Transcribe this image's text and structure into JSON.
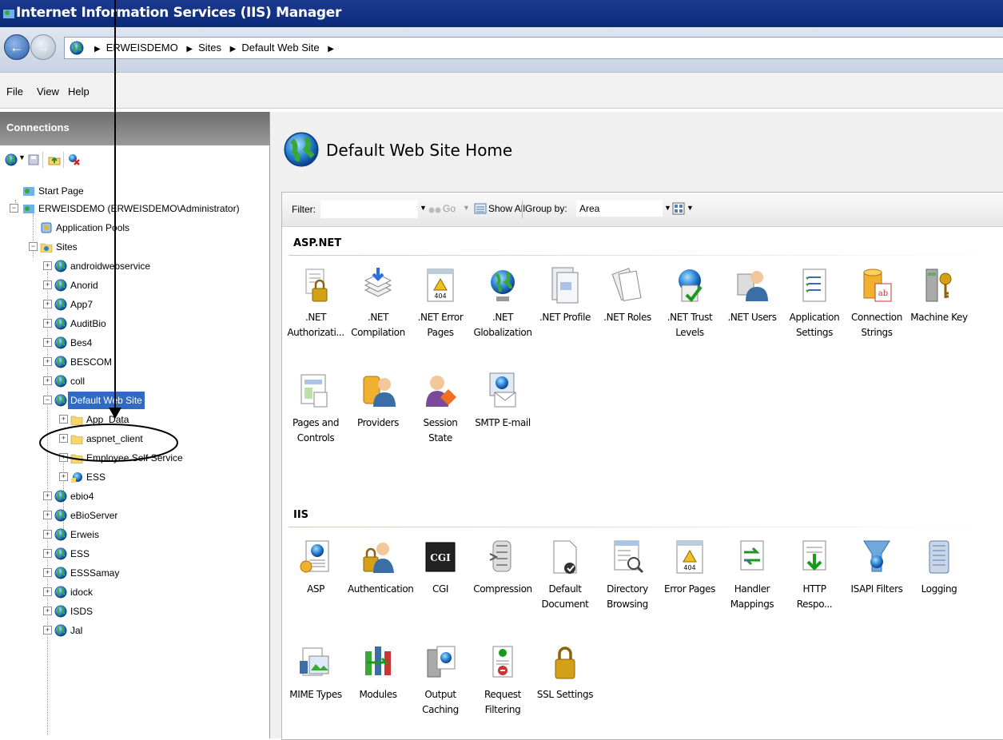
{
  "window": {
    "title": "Internet Information Services (IIS) Manager"
  },
  "address": {
    "crumbs": [
      "ERWEISDEMO",
      "Sites",
      "Default Web Site"
    ]
  },
  "menu": [
    "File",
    "View",
    "Help"
  ],
  "connections": {
    "header": "Connections",
    "tree": {
      "start_page": "Start Page",
      "server": "ERWEISDEMO (ERWEISDEMO\\Administrator)",
      "app_pools": "Application Pools",
      "sites": "Sites",
      "site_items": [
        "androidwebservice",
        "Anorid",
        "App7",
        "AuditBio",
        "Bes4",
        "BESCOM",
        "coll"
      ],
      "selected_site": "Default Web Site",
      "children": [
        "App_Data",
        "aspnet_client",
        "Employee Self Service",
        "ESS"
      ],
      "more_sites": [
        "ebio4",
        "eBioServer",
        "Erweis",
        "ESS",
        "ESSSamay",
        "idock",
        "ISDS",
        "Jal"
      ]
    }
  },
  "main": {
    "title": "Default Web Site Home",
    "filter": {
      "label": "Filter:",
      "go": "Go",
      "show_all": "Show All",
      "group_by_label": "Group by:",
      "group_by_value": "Area"
    },
    "sections": [
      {
        "name": "ASP.NET",
        "items": [
          {
            "l1": ".NET",
            "l2": "Authorizati...",
            "icon": "lock-icon"
          },
          {
            "l1": ".NET",
            "l2": "Compilation",
            "icon": "stack-icon"
          },
          {
            "l1": ".NET Error",
            "l2": "Pages",
            "icon": "warning-404-icon"
          },
          {
            "l1": ".NET",
            "l2": "Globalization",
            "icon": "globe-icon"
          },
          {
            "l1": ".NET Profile",
            "l2": "",
            "icon": "profile-icon"
          },
          {
            "l1": ".NET Roles",
            "l2": "",
            "icon": "roles-icon"
          },
          {
            "l1": ".NET Trust",
            "l2": "Levels",
            "icon": "trust-icon"
          },
          {
            "l1": ".NET Users",
            "l2": "",
            "icon": "users-icon"
          },
          {
            "l1": "Application",
            "l2": "Settings",
            "icon": "settings-list-icon"
          },
          {
            "l1": "Connection",
            "l2": "Strings",
            "icon": "db-icon"
          },
          {
            "l1": "Machine Key",
            "l2": "",
            "icon": "key-icon"
          },
          {
            "l1": "Pages and",
            "l2": "Controls",
            "icon": "pages-icon"
          },
          {
            "l1": "Providers",
            "l2": "",
            "icon": "providers-icon"
          },
          {
            "l1": "Session State",
            "l2": "",
            "icon": "session-icon"
          },
          {
            "l1": "SMTP E-mail",
            "l2": "",
            "icon": "mail-icon"
          }
        ]
      },
      {
        "name": "IIS",
        "items": [
          {
            "l1": "ASP",
            "l2": "",
            "icon": "asp-icon"
          },
          {
            "l1": "Authentication",
            "l2": "",
            "icon": "auth-icon"
          },
          {
            "l1": "CGI",
            "l2": "",
            "icon": "cgi-icon"
          },
          {
            "l1": "Compression",
            "l2": "",
            "icon": "compression-icon"
          },
          {
            "l1": "Default",
            "l2": "Document",
            "icon": "document-icon"
          },
          {
            "l1": "Directory",
            "l2": "Browsing",
            "icon": "directory-icon"
          },
          {
            "l1": "Error Pages",
            "l2": "",
            "icon": "error-pages-icon"
          },
          {
            "l1": "Handler",
            "l2": "Mappings",
            "icon": "handler-icon"
          },
          {
            "l1": "HTTP",
            "l2": "Respo...",
            "icon": "http-icon"
          },
          {
            "l1": "ISAPI Filters",
            "l2": "",
            "icon": "filter-icon"
          },
          {
            "l1": "Logging",
            "l2": "",
            "icon": "log-icon"
          },
          {
            "l1": "MIME Types",
            "l2": "",
            "icon": "mime-icon"
          },
          {
            "l1": "Modules",
            "l2": "",
            "icon": "modules-icon"
          },
          {
            "l1": "Output",
            "l2": "Caching",
            "icon": "cache-icon"
          },
          {
            "l1": "Request",
            "l2": "Filtering",
            "icon": "request-icon"
          },
          {
            "l1": "SSL Settings",
            "l2": "",
            "icon": "ssl-icon"
          }
        ]
      }
    ]
  },
  "colors": {
    "title_bar": "#0c2a7a",
    "selection": "#316ac5",
    "connections_header": "#808080"
  }
}
